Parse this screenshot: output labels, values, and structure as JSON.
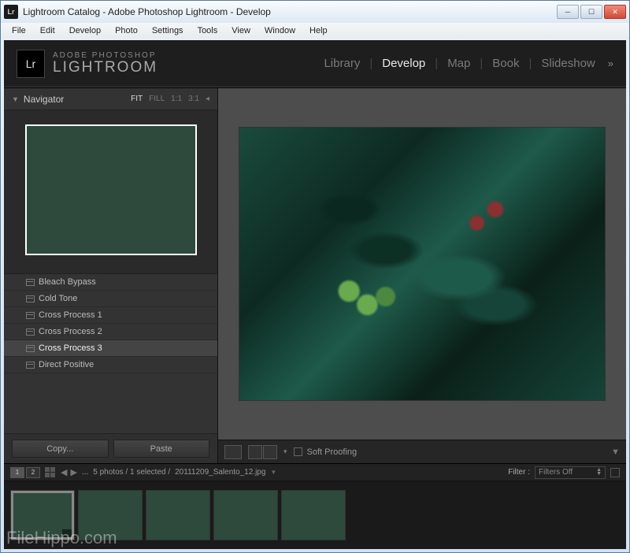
{
  "titlebar": {
    "logo": "Lr",
    "title": "Lightroom Catalog - Adobe Photoshop Lightroom - Develop"
  },
  "menubar": [
    "File",
    "Edit",
    "Develop",
    "Photo",
    "Settings",
    "Tools",
    "View",
    "Window",
    "Help"
  ],
  "brand": {
    "line1": "ADOBE PHOTOSHOP",
    "line2": "LIGHTROOM"
  },
  "modules": {
    "items": [
      "Library",
      "Develop",
      "Map",
      "Book",
      "Slideshow"
    ],
    "active": "Develop",
    "more": "»"
  },
  "navigator": {
    "label": "Navigator",
    "zoom": [
      "FIT",
      "FILL",
      "1:1",
      "3:1"
    ],
    "zoom_active": "FIT"
  },
  "presets": {
    "items": [
      "Bleach Bypass",
      "Cold Tone",
      "Cross Process 1",
      "Cross Process 2",
      "Cross Process 3",
      "Direct Positive"
    ],
    "selected": "Cross Process 3"
  },
  "buttons": {
    "copy": "Copy...",
    "paste": "Paste"
  },
  "softproof": {
    "label": "Soft Proofing"
  },
  "filmstrip": {
    "screen1": "1",
    "screen2": "2",
    "ellipsis": "...",
    "info": "5 photos / 1 selected /",
    "filename": "20111209_Salento_12.jpg",
    "filter_label": "Filter :",
    "filter_value": "Filters Off"
  },
  "watermark": "FileHippo.com"
}
